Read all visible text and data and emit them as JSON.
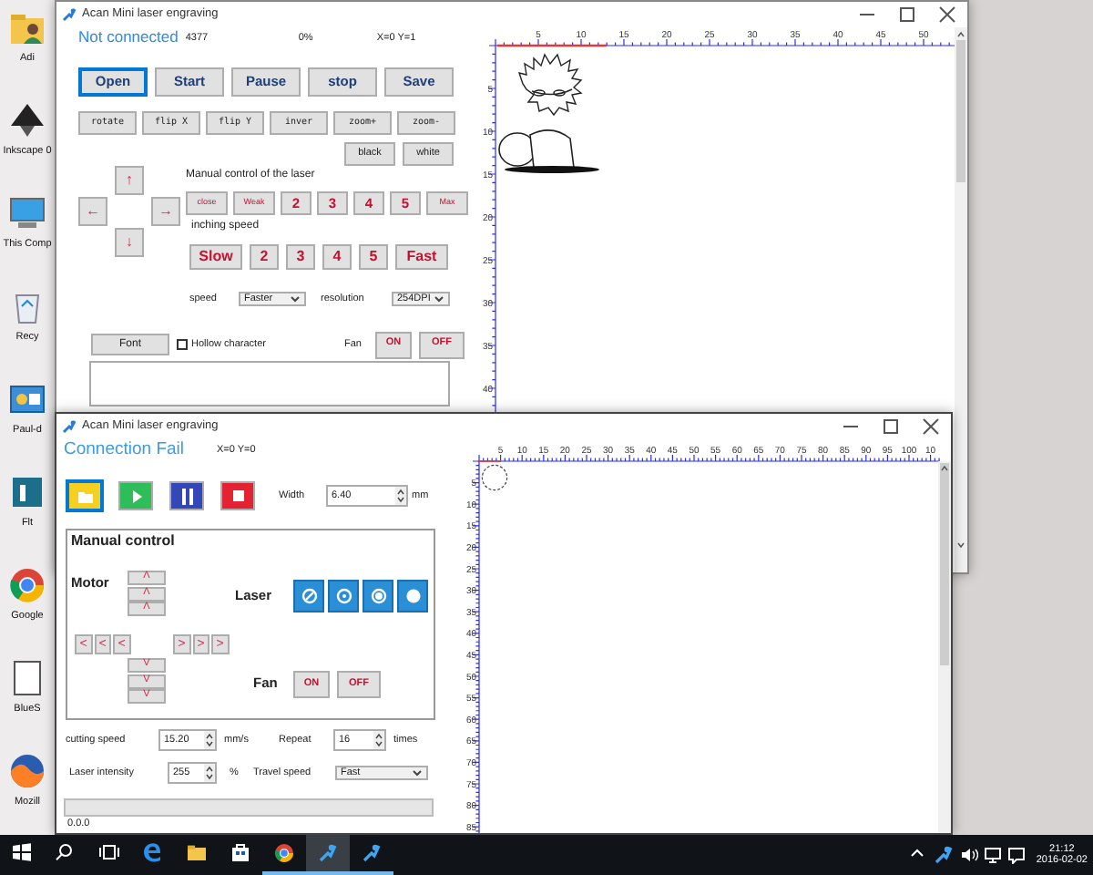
{
  "desktop_icons": [
    {
      "label": "Adi",
      "kind": "user-folder"
    },
    {
      "label": "Inkscape 0",
      "kind": "vector-app"
    },
    {
      "label": "This Comp",
      "kind": "computer"
    },
    {
      "label": "Recy",
      "kind": "recycle-bin"
    },
    {
      "label": "Paul-d",
      "kind": "shortcut"
    },
    {
      "label": "Flt",
      "kind": "app"
    },
    {
      "label": "Google",
      "kind": "browser"
    },
    {
      "label": "BlueS",
      "kind": "document"
    },
    {
      "label": "Mozill",
      "kind": "fox-browser"
    }
  ],
  "window_1": {
    "title": "Acan Mini laser engraving",
    "status": "Not connected",
    "count": "4377",
    "percent": "0%",
    "position": "X=0 Y=1",
    "main_buttons": [
      {
        "label": "Open",
        "focused": true
      },
      {
        "label": "Start",
        "focused": false
      },
      {
        "label": "Pause",
        "focused": false
      },
      {
        "label": "stop",
        "focused": false
      },
      {
        "label": "Save",
        "focused": false
      }
    ],
    "tool_buttons": [
      {
        "label": "rotate"
      },
      {
        "label": "flip X"
      },
      {
        "label": "flip Y"
      },
      {
        "label": "inver"
      },
      {
        "label": "zoom+"
      },
      {
        "label": "zoom-"
      }
    ],
    "color_buttons": [
      {
        "label": "black"
      },
      {
        "label": "white"
      }
    ],
    "arrows": [
      {
        "label": "↑",
        "kind": "up"
      },
      {
        "label": "←",
        "kind": "left"
      },
      {
        "label": "→",
        "kind": "right"
      },
      {
        "label": "↓",
        "kind": "down"
      }
    ],
    "laser_heading": "Manual control of the laser",
    "laser_buttons": [
      {
        "label": "close",
        "kind": "word"
      },
      {
        "label": "Weak",
        "kind": "word"
      },
      {
        "label": "2",
        "kind": "digit"
      },
      {
        "label": "3",
        "kind": "digit"
      },
      {
        "label": "4",
        "kind": "digit"
      },
      {
        "label": "5",
        "kind": "digit"
      },
      {
        "label": "Max",
        "kind": "word"
      }
    ],
    "inching_heading": "inching speed",
    "inching_buttons": [
      {
        "label": "Slow",
        "kind": "word"
      },
      {
        "label": "2",
        "kind": "digit"
      },
      {
        "label": "3",
        "kind": "digit"
      },
      {
        "label": "4",
        "kind": "digit"
      },
      {
        "label": "5",
        "kind": "digit"
      },
      {
        "label": "Fast",
        "kind": "word"
      }
    ],
    "speed": {
      "label": "speed",
      "value": "Faster"
    },
    "resolution": {
      "label": "resolution",
      "value": "254DPI"
    },
    "font_button": "Font",
    "hollow": {
      "label": "Hollow character",
      "checked": false
    },
    "fan": {
      "label": "Fan",
      "buttons": [
        "ON",
        "OFF"
      ]
    },
    "x_ticks": [
      "5",
      "10",
      "15",
      "20",
      "25",
      "30",
      "35",
      "40",
      "45",
      "50"
    ],
    "y_ticks": [
      "5",
      "10",
      "15",
      "20",
      "25",
      "30",
      "35",
      "40"
    ]
  },
  "window_2": {
    "title": "Acan Mini laser engraving",
    "status": "Connection Fail",
    "position": "X=0 Y=0",
    "tool_buttons": [
      {
        "kind": "open",
        "focused": true
      },
      {
        "kind": "start",
        "focused": false
      },
      {
        "kind": "pause",
        "focused": false
      },
      {
        "kind": "stop",
        "focused": false
      }
    ],
    "width": {
      "label": "Width",
      "value": "6.40",
      "unit": "mm"
    },
    "manual": {
      "title": "Manual control",
      "motor_label": "Motor",
      "up": [
        "Λ",
        "Λ",
        "Λ"
      ],
      "left": [
        "<",
        "<",
        "<"
      ],
      "right": [
        ">",
        ">",
        ">"
      ],
      "down": [
        "V",
        "V",
        "V"
      ],
      "laser_label": "Laser",
      "laser_buttons": [
        {
          "kind": "off"
        },
        {
          "kind": "low"
        },
        {
          "kind": "mid"
        },
        {
          "kind": "high"
        }
      ],
      "fan_label": "Fan",
      "fan_buttons": [
        "ON",
        "OFF"
      ]
    },
    "cutting_speed": {
      "label": "cutting speed",
      "value": "15.20",
      "unit": "mm/s"
    },
    "repeat": {
      "label": "Repeat",
      "value": "16",
      "unit": "times"
    },
    "intensity": {
      "label": "Laser intensity",
      "value": "255",
      "unit": "%"
    },
    "travel_speed": {
      "label": "Travel speed",
      "value": "Fast"
    },
    "progress": {
      "level": 0
    },
    "version": "0.0.0",
    "x_ticks": [
      "5",
      "10",
      "15",
      "20",
      "25",
      "30",
      "35",
      "40",
      "45",
      "50",
      "55",
      "60",
      "65",
      "70",
      "75",
      "80",
      "85",
      "90",
      "95",
      "100",
      "10"
    ],
    "y_ticks": [
      "5",
      "10",
      "15",
      "20",
      "25",
      "30",
      "35",
      "40",
      "45",
      "50",
      "55",
      "60",
      "65",
      "70",
      "75",
      "80",
      "85"
    ]
  },
  "taskbar": {
    "items": [
      {
        "kind": "start",
        "running": false,
        "selected": false
      },
      {
        "kind": "search",
        "running": false,
        "selected": false
      },
      {
        "kind": "task-view",
        "running": false,
        "selected": false
      },
      {
        "kind": "edge",
        "running": false,
        "selected": false
      },
      {
        "kind": "explorer",
        "running": false,
        "selected": false
      },
      {
        "kind": "store",
        "running": false,
        "selected": false
      },
      {
        "kind": "chrome",
        "running": true,
        "selected": false
      },
      {
        "kind": "laser",
        "running": true,
        "selected": true
      },
      {
        "kind": "laser",
        "running": true,
        "selected": false
      }
    ],
    "tray": [
      {
        "kind": "chevron"
      },
      {
        "kind": "laser"
      },
      {
        "kind": "volume"
      },
      {
        "kind": "network"
      },
      {
        "kind": "notification"
      }
    ],
    "time": "21:12",
    "date": "2016-02-02"
  }
}
